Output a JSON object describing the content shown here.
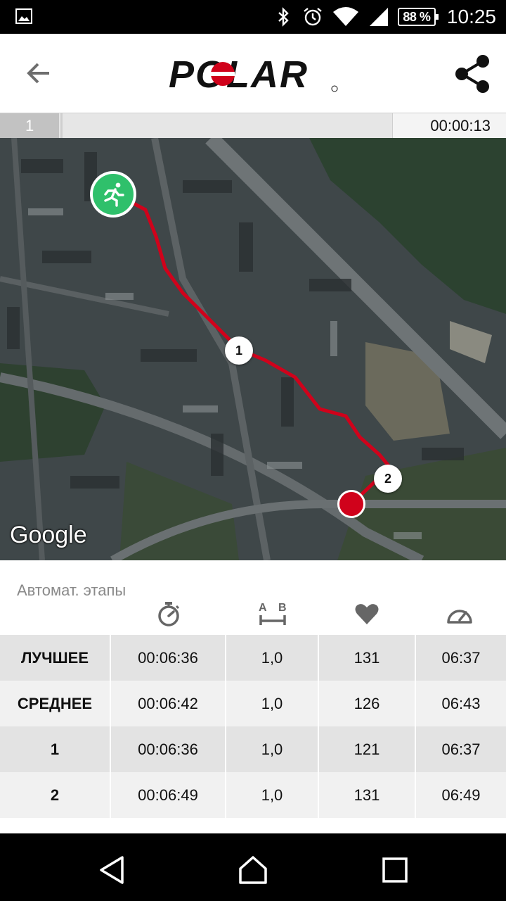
{
  "status_bar": {
    "battery": "88 %",
    "time": "10:25",
    "icons": [
      "gallery-icon",
      "bluetooth-icon",
      "alarm-icon",
      "wifi-icon",
      "signal-icon",
      "battery-icon"
    ]
  },
  "app_bar": {
    "back_icon": "arrow-back-icon",
    "logo_text": "POLAR",
    "share_icon": "share-icon"
  },
  "lap_strip": {
    "lap": "1",
    "time": "00:00:13"
  },
  "map": {
    "attribution": "Google",
    "markers": [
      "1",
      "2"
    ],
    "route_color": "#d0021b",
    "start_color": "#2fc06b"
  },
  "stats": {
    "title": "Автомат. этапы",
    "column_icons": [
      "stopwatch-icon",
      "distance-ab-icon",
      "heart-icon",
      "pace-gauge-icon"
    ],
    "distance_icon_labels": [
      "A",
      "B"
    ],
    "rows": [
      {
        "label": "ЛУЧШЕЕ",
        "time": "00:06:36",
        "distance": "1,0",
        "hr": "131",
        "pace": "06:37"
      },
      {
        "label": "СРЕДНЕЕ",
        "time": "00:06:42",
        "distance": "1,0",
        "hr": "126",
        "pace": "06:43"
      },
      {
        "label": "1",
        "time": "00:06:36",
        "distance": "1,0",
        "hr": "121",
        "pace": "06:37"
      },
      {
        "label": "2",
        "time": "00:06:49",
        "distance": "1,0",
        "hr": "131",
        "pace": "06:49"
      }
    ]
  },
  "nav_bar": {
    "buttons": [
      "back-triangle-icon",
      "home-icon",
      "recents-icon"
    ]
  }
}
